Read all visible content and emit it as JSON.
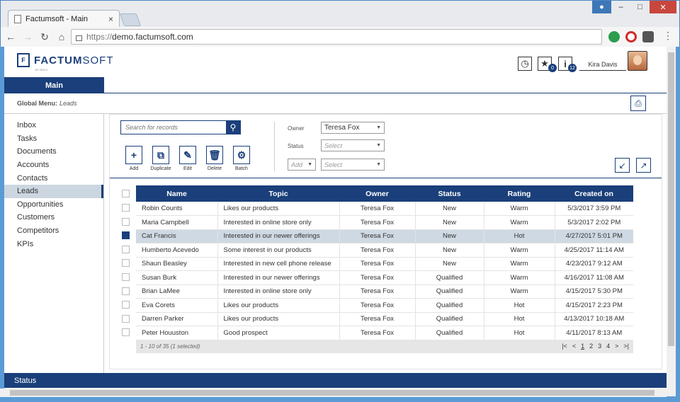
{
  "browser": {
    "tab_title": "Factumsoft - Main",
    "tab_close": "×",
    "url_scheme": "https://",
    "url_host": "demo.factumsoft.com"
  },
  "header": {
    "brand_bold": "FACTUM",
    "brand_light": "SOFT",
    "brand_by": "BY BOLD",
    "favorites_count": "0",
    "info_count": "12",
    "user_name": "Kira Davis"
  },
  "main_tab": "Main",
  "global_menu": {
    "label": "Global Menu:",
    "value": "Leads"
  },
  "sidebar": {
    "items": [
      "Inbox",
      "Tasks",
      "Documents",
      "Accounts",
      "Contacts",
      "Leads",
      "Opportunities",
      "Customers",
      "Competitors",
      "KPIs"
    ],
    "active_index": 5
  },
  "search": {
    "placeholder": "Search for records"
  },
  "actions": [
    "Add",
    "Duplicate",
    "Edit",
    "Delete",
    "Batch"
  ],
  "filters": {
    "owner_label": "Owner",
    "owner_value": "Teresa Fox",
    "status_label": "Status",
    "status_placeholder": "Select",
    "add_placeholder": "Add",
    "extra_placeholder": "Select"
  },
  "table": {
    "columns": [
      "Name",
      "Topic",
      "Owner",
      "Status",
      "Rating",
      "Created on"
    ],
    "rows": [
      [
        "Robin Counts",
        "Likes our products",
        "Teresa Fox",
        "New",
        "Warm",
        "5/3/2017 3:59 PM"
      ],
      [
        "Maria Campbell",
        "Interested in online store only",
        "Teresa Fox",
        "New",
        "Warm",
        "5/3/2017 2:02 PM"
      ],
      [
        "Cat Francis",
        "Interested in our newer offerings",
        "Teresa Fox",
        "New",
        "Hot",
        "4/27/2017 5:01 PM"
      ],
      [
        "Humberto Acevedo",
        "Some interest in our products",
        "Teresa Fox",
        "New",
        "Warm",
        "4/25/2017 11:14 AM"
      ],
      [
        "Shaun Beasley",
        "Interested in new cell phone release",
        "Teresa Fox",
        "New",
        "Warm",
        "4/23/2017 9:12 AM"
      ],
      [
        "Susan Burk",
        "Interested in our newer offerings",
        "Teresa Fox",
        "Qualified",
        "Warm",
        "4/16/2017 11:08 AM"
      ],
      [
        "Brian LaMee",
        "Interested in online store only",
        "Teresa Fox",
        "Qualified",
        "Warm",
        "4/15/2017 5:30 PM"
      ],
      [
        "Eva Corets",
        "Likes our products",
        "Teresa Fox",
        "Qualified",
        "Hot",
        "4/15/2017 2:23 PM"
      ],
      [
        "Darren Parker",
        "Likes our products",
        "Teresa Fox",
        "Qualified",
        "Hot",
        "4/13/2017 10:18 AM"
      ],
      [
        "Peter Houuston",
        "Good prospect",
        "Teresa Fox",
        "Qualified",
        "Hot",
        "4/11/2017 8:13 AM"
      ]
    ],
    "selected_index": 2,
    "summary": "1 - 10 of 35 (1 selected)",
    "pager": [
      "|<",
      "<",
      "1",
      "2",
      "3",
      "4",
      ">",
      ">|"
    ],
    "current_page": "1"
  },
  "status_bar": "Status",
  "colors": {
    "brand": "#1a3f7a",
    "selected_row": "#cfd9e3"
  }
}
